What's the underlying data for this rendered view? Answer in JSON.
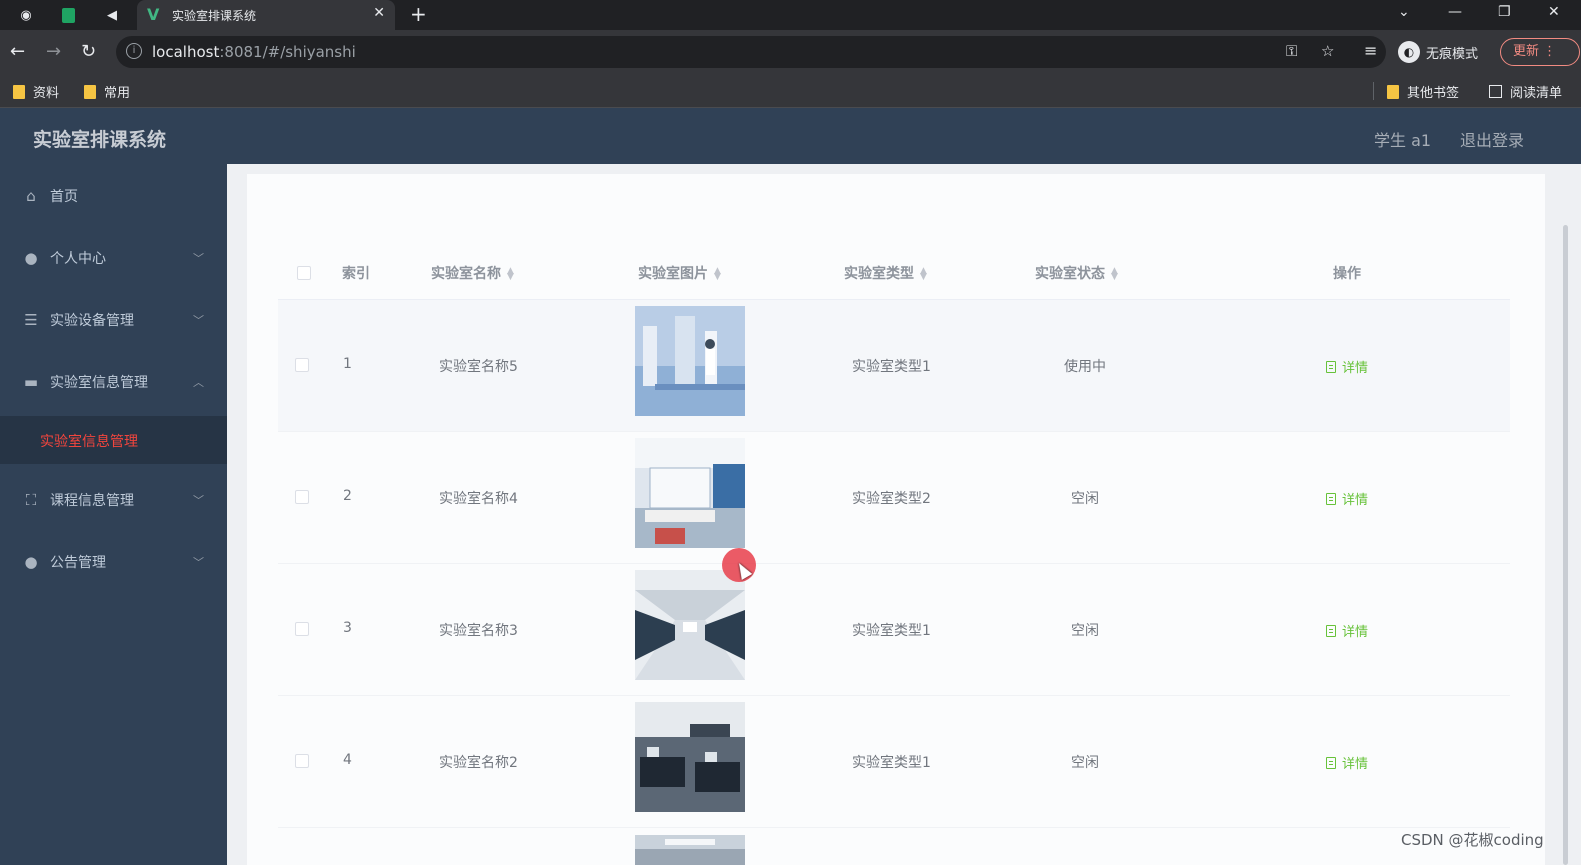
{
  "browser": {
    "tab_title": "实验室排课系统",
    "url_host": "localhost",
    "url_path": ":8081/#/shiyanshi",
    "incognito_label": "无痕模式",
    "update_label": "更新",
    "bookmarks": [
      "资料",
      "常用"
    ],
    "bookmarks_right": [
      "其他书签",
      "阅读清单"
    ]
  },
  "header": {
    "title": "实验室排课系统",
    "user": "学生 a1",
    "logout": "退出登录"
  },
  "sidebar": {
    "items": [
      {
        "label": "首页",
        "icon": "home-icon"
      },
      {
        "label": "个人中心",
        "icon": "user-icon"
      },
      {
        "label": "实验设备管理",
        "icon": "sliders-icon"
      },
      {
        "label": "实验室信息管理",
        "icon": "message-icon"
      },
      {
        "label": "课程信息管理",
        "icon": "fullscreen-icon"
      },
      {
        "label": "公告管理",
        "icon": "user-icon"
      }
    ],
    "active_sub": "实验室信息管理"
  },
  "table": {
    "headers": {
      "index": "索引",
      "name": "实验室名称",
      "image": "实验室图片",
      "type": "实验室类型",
      "status": "实验室状态",
      "action": "操作"
    },
    "rows": [
      {
        "index": "1",
        "name": "实验室名称5",
        "type": "实验室类型1",
        "status": "使用中",
        "action": "详情"
      },
      {
        "index": "2",
        "name": "实验室名称4",
        "type": "实验室类型2",
        "status": "空闲",
        "action": "详情"
      },
      {
        "index": "3",
        "name": "实验室名称3",
        "type": "实验室类型1",
        "status": "空闲",
        "action": "详情"
      },
      {
        "index": "4",
        "name": "实验室名称2",
        "type": "实验室类型1",
        "status": "空闲",
        "action": "详情"
      }
    ]
  },
  "watermark": "CSDN @花椒coding"
}
